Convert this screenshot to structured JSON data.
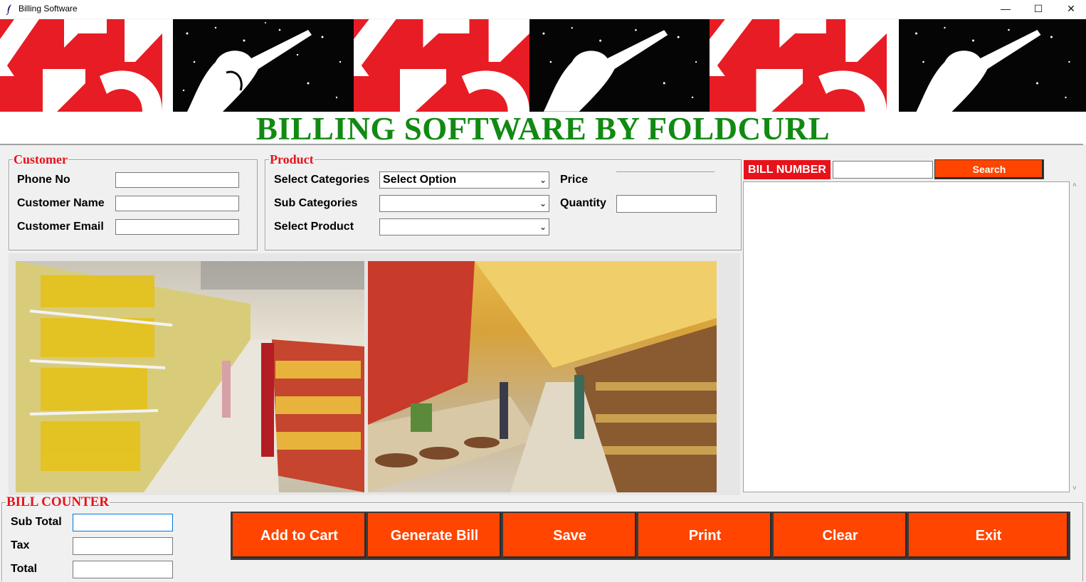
{
  "window": {
    "title": "Billing Software",
    "minimize_glyph": "—",
    "maximize_glyph": "☐",
    "close_glyph": "✕"
  },
  "banner": {
    "alt": "banner with red logo and starry silhouette tiles"
  },
  "heading": "BILLING SOFTWARE BY FOLDCURL",
  "customer": {
    "legend": "Customer",
    "phone_label": "Phone No",
    "phone_value": "",
    "name_label": "Customer Name",
    "name_value": "",
    "email_label": "Customer Email",
    "email_value": ""
  },
  "product": {
    "legend": "Product",
    "category_label": "Select Categories",
    "category_value": "Select Option",
    "subcategory_label": "Sub Categories",
    "subcategory_value": "",
    "product_label": "Select Product",
    "product_value": "",
    "price_label": "Price",
    "price_value": "",
    "quantity_label": "Quantity",
    "quantity_value": ""
  },
  "bill_search": {
    "label": "BILL NUMBER",
    "value": "",
    "button": "Search"
  },
  "bill_counter": {
    "legend": "BILL COUNTER",
    "subtotal_label": "Sub Total",
    "subtotal_value": "",
    "tax_label": "Tax",
    "tax_value": "",
    "total_label": "Total",
    "total_value": ""
  },
  "actions": [
    "Add to Cart",
    "Generate Bill",
    "Save",
    "Print",
    "Clear",
    "Exit"
  ],
  "colors": {
    "accent": "#ff4500",
    "legend": "#e8121b",
    "heading": "#118a11",
    "banner_red": "#e81c24"
  },
  "icons": [
    "feather-icon",
    "minimize-icon",
    "maximize-icon",
    "close-icon",
    "chevron-down-icon"
  ]
}
